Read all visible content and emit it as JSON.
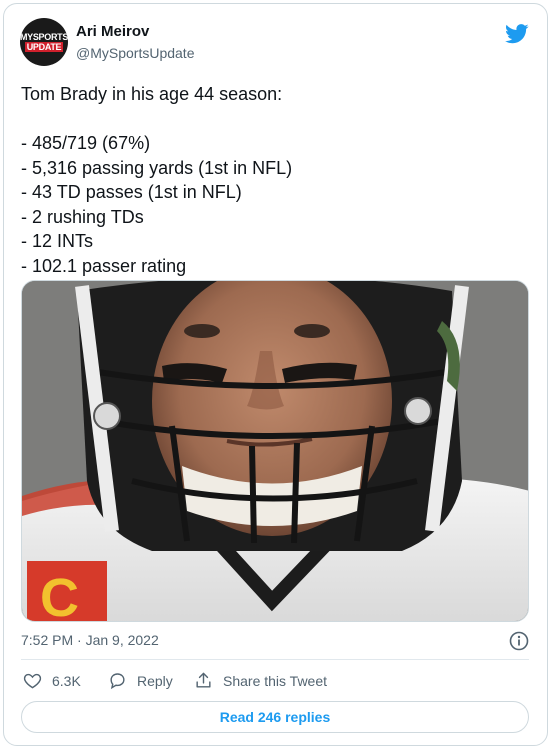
{
  "author": {
    "name": "Ari Meirov",
    "handle": "@MySportsUpdate",
    "avatar_text_top": "MYSPORTS",
    "avatar_text_bottom": "UPDATE"
  },
  "tweet": {
    "lines": [
      "Tom Brady in his age 44 season:",
      "",
      "- 485/719 (67%)",
      "- 5,316 passing yards (1st in NFL)",
      "- 43 TD passes (1st in NFL)",
      "- 2 rushing TDs",
      "- 12 INTs",
      "- 102.1 passer rating"
    ],
    "timestamp": "7:52 PM · Jan 9, 2022"
  },
  "actions": {
    "like_count": "6.3K",
    "reply_label": "Reply",
    "share_label": "Share this Tweet",
    "read_replies_label": "Read 246 replies"
  },
  "icons": [
    "twitter-bird-icon",
    "info-icon",
    "heart-icon",
    "reply-icon",
    "share-icon"
  ],
  "colors": {
    "twitter_blue": "#1d9bf0",
    "text_primary": "#0f1419",
    "text_secondary": "#536471",
    "border": "#cfd9de"
  }
}
